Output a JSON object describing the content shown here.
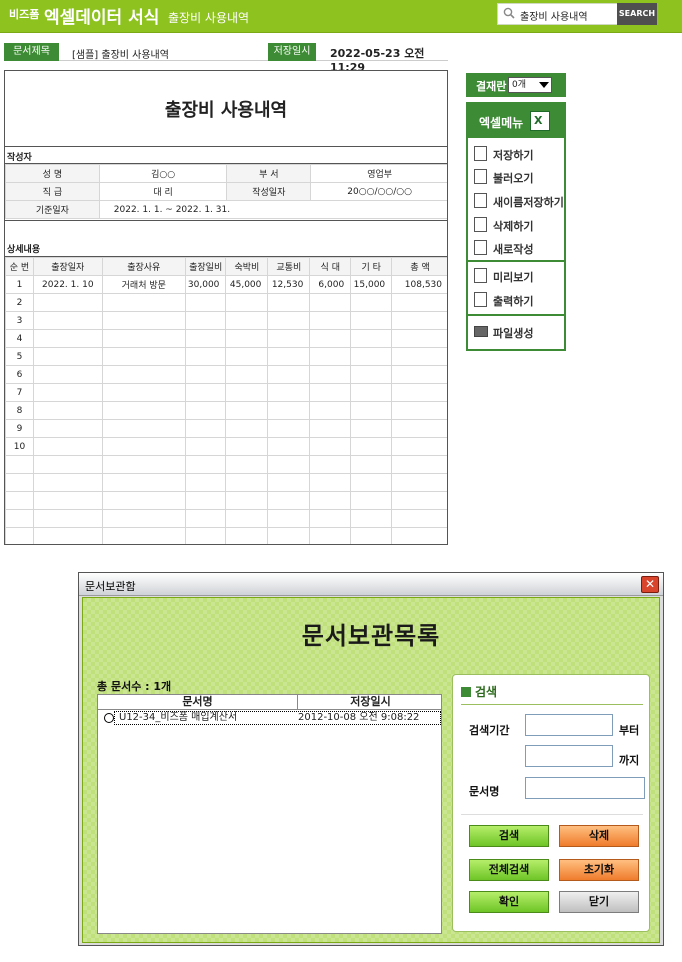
{
  "header": {
    "brand": "비즈폼",
    "app_title": "엑셀데이터 서식",
    "subtitle": "출장비 사용내역",
    "search_value": "출장비 사용내역",
    "search_button": "SEARCH"
  },
  "info_bar": {
    "doc_title_label": "문서제목",
    "doc_title_value": "[샘플] 출장비 사용내역",
    "saved_label": "저장일시",
    "saved_value": "2022-05-23  오전 11:29"
  },
  "document": {
    "title": "출장비 사용내역",
    "author_section": "작성자",
    "author_rows": [
      {
        "k1": "성  명",
        "v1": "김○○",
        "k2": "부  서",
        "v2": "영업부"
      },
      {
        "k1": "직  급",
        "v1": "대  리",
        "k2": "작성일자",
        "v2": "20○○/○○/○○"
      }
    ],
    "base_date_label": "기준일자",
    "base_date_value": "2022. 1. 1. ~ 2022. 1. 31.",
    "detail_section": "상세내용",
    "columns": [
      "순 번",
      "출장일자",
      "출장사유",
      "출장일비",
      "숙박비",
      "교통비",
      "식 대",
      "기 타",
      "총 액"
    ],
    "rows": [
      [
        "1",
        "2022. 1. 10",
        "거래처 방문",
        "30,000",
        "45,000",
        "12,530",
        "6,000",
        "15,000",
        "108,530"
      ],
      [
        "2",
        "",
        "",
        "",
        "",
        "",
        "",
        "",
        ""
      ],
      [
        "3",
        "",
        "",
        "",
        "",
        "",
        "",
        "",
        ""
      ],
      [
        "4",
        "",
        "",
        "",
        "",
        "",
        "",
        "",
        ""
      ],
      [
        "5",
        "",
        "",
        "",
        "",
        "",
        "",
        "",
        ""
      ],
      [
        "6",
        "",
        "",
        "",
        "",
        "",
        "",
        "",
        ""
      ],
      [
        "7",
        "",
        "",
        "",
        "",
        "",
        "",
        "",
        ""
      ],
      [
        "8",
        "",
        "",
        "",
        "",
        "",
        "",
        "",
        ""
      ],
      [
        "9",
        "",
        "",
        "",
        "",
        "",
        "",
        "",
        ""
      ],
      [
        "10",
        "",
        "",
        "",
        "",
        "",
        "",
        "",
        ""
      ]
    ]
  },
  "approval": {
    "label": "결재란",
    "value": "0개"
  },
  "excel_menu": {
    "title": "엑셀메뉴",
    "items": [
      "저장하기",
      "불러오기",
      "새이름저장하기",
      "삭제하기",
      "새로작성",
      "미리보기",
      "출력하기",
      "파일생성"
    ]
  },
  "dialog": {
    "window_title": "문서보관함",
    "heading": "문서보관목록",
    "count_text": "총 문서수 : 1개",
    "col_name": "문서명",
    "col_date": "저장일시",
    "entries": [
      {
        "name": "U12-34_비즈폼 매입계산서",
        "date": "2012-10-08 오전 9:08:22"
      }
    ],
    "search": {
      "title": "검색",
      "period_label": "검색기간",
      "from_label": "부터",
      "to_label": "까지",
      "name_label": "문서명",
      "buttons": {
        "search": "검색",
        "delete": "삭제",
        "search_all": "전체검색",
        "reset": "초기화",
        "ok": "확인",
        "close": "닫기"
      }
    }
  }
}
